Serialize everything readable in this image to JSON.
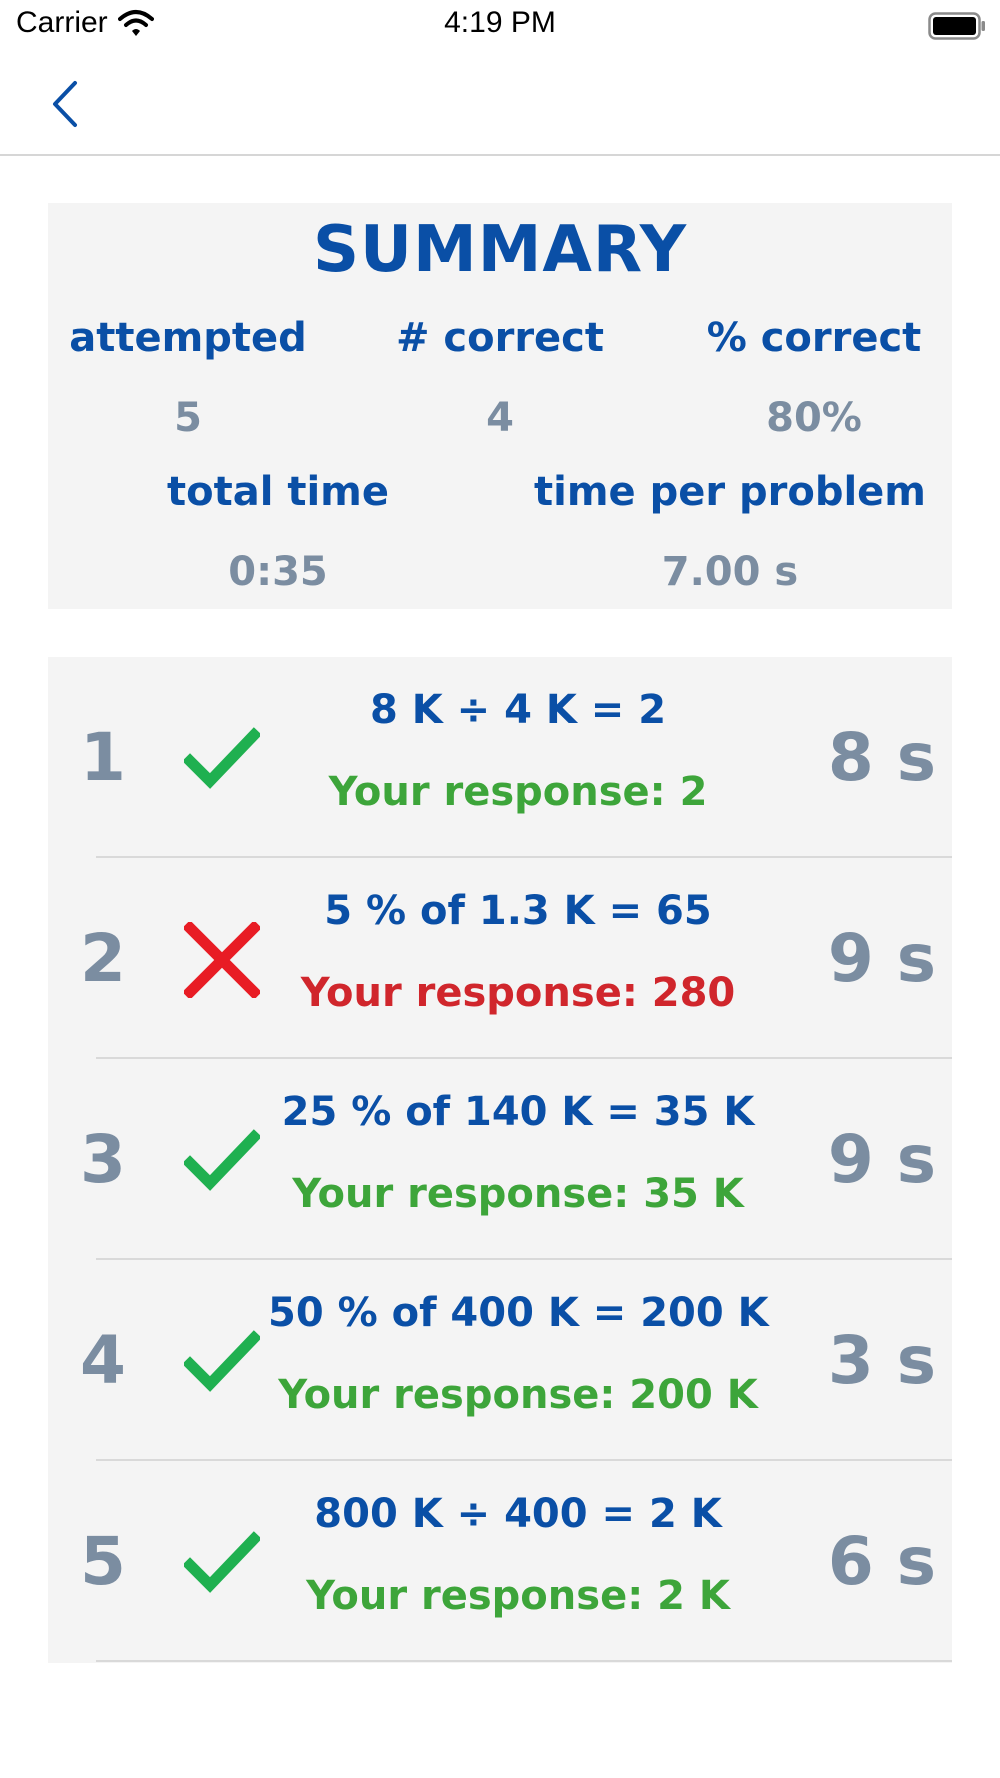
{
  "status_bar": {
    "carrier": "Carrier",
    "time": "4:19 PM",
    "icons": [
      "wifi-icon",
      "battery-icon"
    ]
  },
  "nav": {
    "back_icon": "chevron-left-icon"
  },
  "colors": {
    "brand_blue": "#0a4fa6",
    "value_gray": "#7b8da1",
    "correct_green": "#1fb050",
    "correct_text_green": "#3da53a",
    "wrong_red": "#e81c24",
    "wrong_text_red": "#d0262c",
    "card_bg": "#f4f4f4"
  },
  "summary": {
    "title": "SUMMARY",
    "attempted_label": "attempted",
    "attempted_value": "5",
    "correct_label": "# correct",
    "correct_value": "4",
    "percent_label": "% correct",
    "percent_value": "80%",
    "total_time_label": "total time",
    "total_time_value": "0:35",
    "time_per_problem_label": "time per problem",
    "time_per_problem_value": "7.00 s"
  },
  "results": [
    {
      "index": "1",
      "status": "correct",
      "status_icon": "checkmark-icon",
      "problem": "8 K ÷ 4 K = 2",
      "response": "Your response: 2",
      "time": "8 s"
    },
    {
      "index": "2",
      "status": "wrong",
      "status_icon": "cross-icon",
      "problem": "5 % of 1.3 K = 65",
      "response": "Your response: 280",
      "time": "9 s"
    },
    {
      "index": "3",
      "status": "correct",
      "status_icon": "checkmark-icon",
      "problem": "25 % of 140 K = 35 K",
      "response": "Your response: 35 K",
      "time": "9 s"
    },
    {
      "index": "4",
      "status": "correct",
      "status_icon": "checkmark-icon",
      "problem": "50 % of 400 K = 200 K",
      "response": "Your response: 200 K",
      "time": "3 s"
    },
    {
      "index": "5",
      "status": "correct",
      "status_icon": "checkmark-icon",
      "problem": "800 K ÷ 400 = 2 K",
      "response": "Your response: 2 K",
      "time": "6 s"
    }
  ]
}
